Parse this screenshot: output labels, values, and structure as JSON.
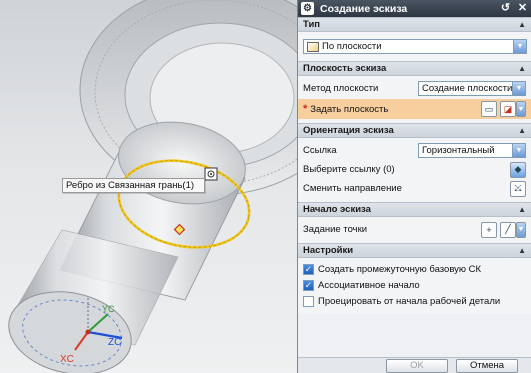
{
  "viewport": {
    "tooltip": "Ребро из Связанная грань(1)",
    "axes": {
      "x": "XC",
      "y": "YC",
      "z": "ZC"
    },
    "colors": {
      "edge": "#f0c419",
      "x_axis": "#d93a2a",
      "y_axis": "#2f9a3a",
      "z_axis": "#1f4fd8"
    }
  },
  "dialog": {
    "title": "Создание эскиза",
    "sections": {
      "type": {
        "header": "Тип",
        "value": "По плоскости"
      },
      "plane": {
        "header": "Плоскость эскиза",
        "method_label": "Метод плоскости",
        "method_value": "Создание плоскости",
        "specify_label": "Задать плоскость",
        "required_mark": "*"
      },
      "orientation": {
        "header": "Ориентация эскиза",
        "reference_label": "Ссылка",
        "reference_value": "Горизонтальный",
        "select_ref_label": "Выберите ссылку (0)",
        "reverse_label": "Сменить направление"
      },
      "origin": {
        "header": "Начало эскиза",
        "point_label": "Задание точки"
      },
      "settings": {
        "header": "Настройки",
        "options": [
          {
            "label": "Создать промежуточную базовую СК",
            "checked": true
          },
          {
            "label": "Ассоциативное начало",
            "checked": true
          },
          {
            "label": "Проецировать от начала рабочей детали",
            "checked": false
          }
        ]
      }
    },
    "buttons": {
      "ok": "OK",
      "cancel": "Отмена"
    },
    "colors": {
      "titlebar": "#2e3742",
      "highlight": "#f7cf9f",
      "accent": "#1f5fbf"
    }
  }
}
